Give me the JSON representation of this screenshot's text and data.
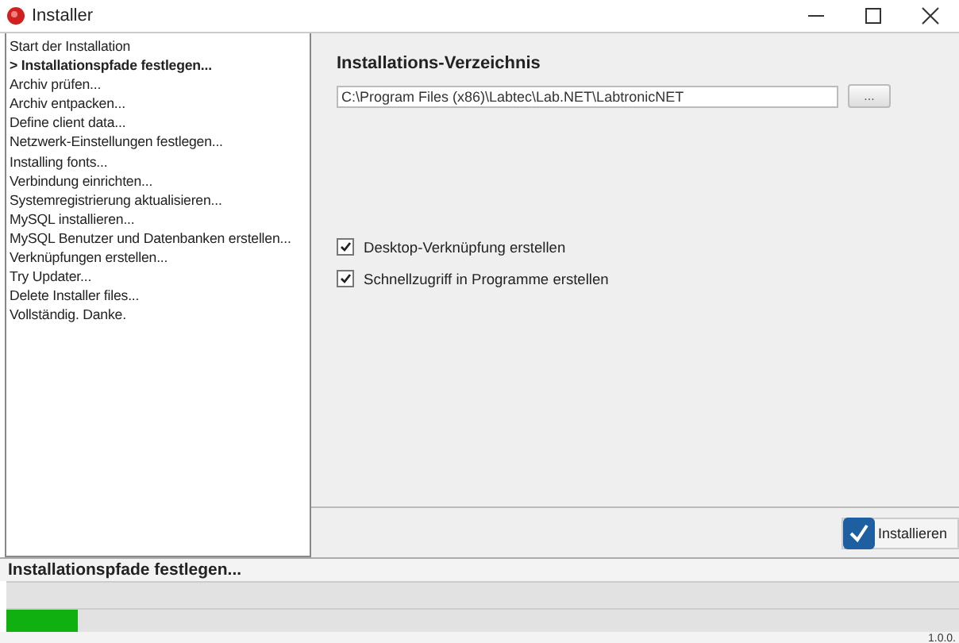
{
  "window": {
    "title": "Installer"
  },
  "steps": [
    {
      "label": "Start der Installation",
      "selected": false
    },
    {
      "label": "> Installationspfade festlegen...",
      "selected": true
    },
    {
      "label": "Archiv prüfen...",
      "selected": false
    },
    {
      "label": "Archiv entpacken...",
      "selected": false
    },
    {
      "label": "Define client data...",
      "selected": false
    },
    {
      "label": "Netzwerk-Einstellungen festlegen...",
      "selected": false
    },
    {
      "label": "Installing fonts...",
      "selected": false
    },
    {
      "label": "Verbindung einrichten...",
      "selected": false
    },
    {
      "label": "Systemregistrierung aktualisieren...",
      "selected": false
    },
    {
      "label": "MySQL installieren...",
      "selected": false
    },
    {
      "label": "MySQL Benutzer und Datenbanken erstellen...",
      "selected": false
    },
    {
      "label": "Verknüpfungen erstellen...",
      "selected": false
    },
    {
      "label": "Try Updater...",
      "selected": false
    },
    {
      "label": "Delete Installer files...",
      "selected": false
    },
    {
      "label": "Vollständig. Danke.",
      "selected": false
    }
  ],
  "directory": {
    "heading": "Installations-Verzeichnis",
    "value": "C:\\Program Files (x86)\\Labtec\\Lab.NET\\LabtronicNET",
    "browse_button": "..."
  },
  "options": [
    {
      "label": "Desktop-Verknüpfung erstellen",
      "checked": true
    },
    {
      "label": "Schnellzugriff in Programme erstellen",
      "checked": true
    }
  ],
  "install_button": "Installieren",
  "status": "Installationspfade festlegen...",
  "progress": {
    "level": 0.075
  },
  "version": "1.0.0."
}
